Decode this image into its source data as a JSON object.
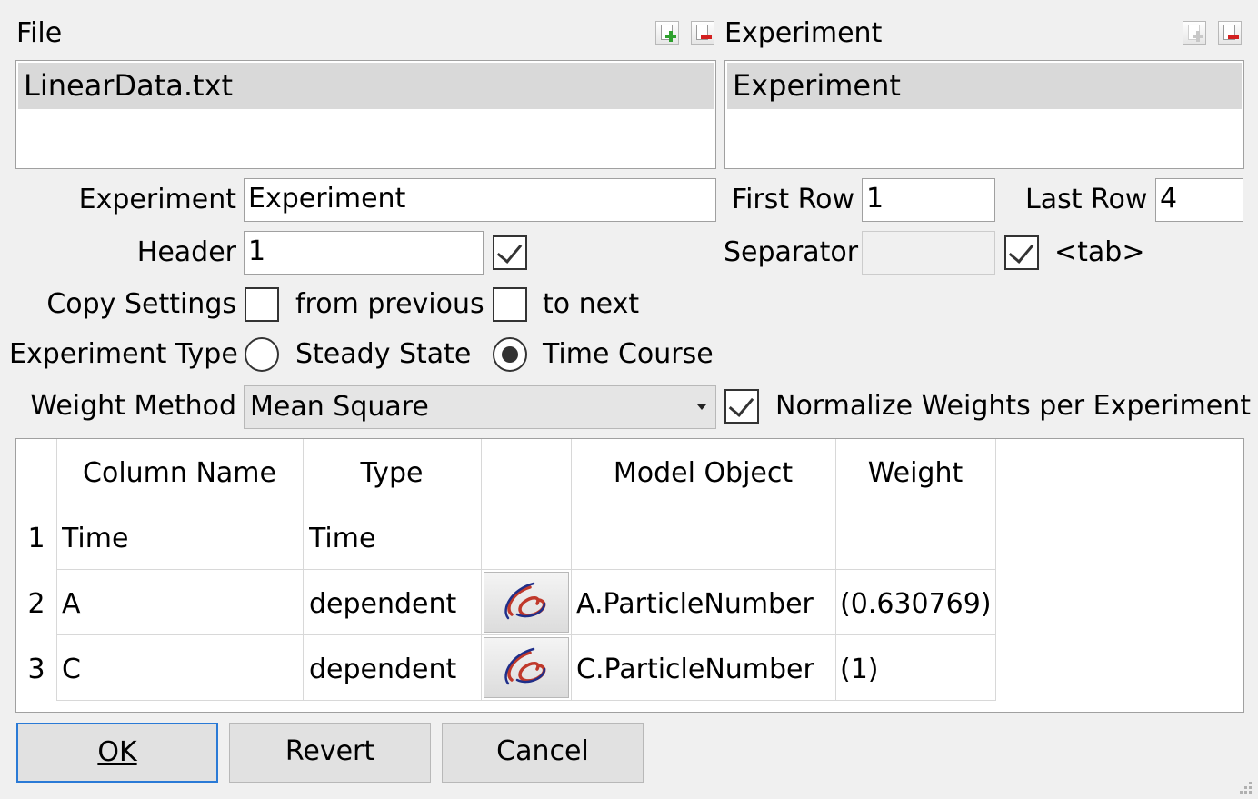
{
  "file_panel": {
    "label": "File",
    "items": [
      "LinearData.txt"
    ],
    "add_icon": "add-doc-icon",
    "remove_icon": "remove-doc-icon"
  },
  "experiment_panel": {
    "label": "Experiment",
    "items": [
      "Experiment"
    ],
    "add_icon": "add-doc-icon",
    "remove_icon": "remove-doc-icon"
  },
  "form": {
    "experiment_label": "Experiment",
    "experiment_value": "Experiment",
    "first_row_label": "First Row",
    "first_row_value": "1",
    "last_row_label": "Last Row",
    "last_row_value": "4",
    "header_label": "Header",
    "header_value": "1",
    "header_checked": true,
    "separator_label": "Separator",
    "separator_value": "",
    "separator_tab_checked": true,
    "tab_label": "<tab>",
    "copy_settings_label": "Copy Settings",
    "from_previous_label": "from previous",
    "to_next_label": "to next",
    "experiment_type_label": "Experiment Type",
    "steady_state_label": "Steady State",
    "time_course_label": "Time Course",
    "experiment_type_selected": "Time Course",
    "weight_method_label": "Weight Method",
    "weight_method_value": "Mean Square",
    "normalize_label": "Normalize Weights per Experiment",
    "normalize_checked": true
  },
  "table": {
    "headers": [
      "Column Name",
      "Type",
      "",
      "Model Object",
      "Weight"
    ],
    "rows": [
      {
        "num": "1",
        "name": "Time",
        "type": "Time",
        "has_button": false,
        "model_object": "",
        "weight": ""
      },
      {
        "num": "2",
        "name": "A",
        "type": "dependent",
        "has_button": true,
        "model_object": "A.ParticleNumber",
        "weight": "(0.630769)"
      },
      {
        "num": "3",
        "name": "C",
        "type": "dependent",
        "has_button": true,
        "model_object": "C.ParticleNumber",
        "weight": "(1)"
      }
    ],
    "graph_icon": "graph-curve-icon"
  },
  "buttons": {
    "ok": "OK",
    "revert": "Revert",
    "cancel": "Cancel"
  }
}
